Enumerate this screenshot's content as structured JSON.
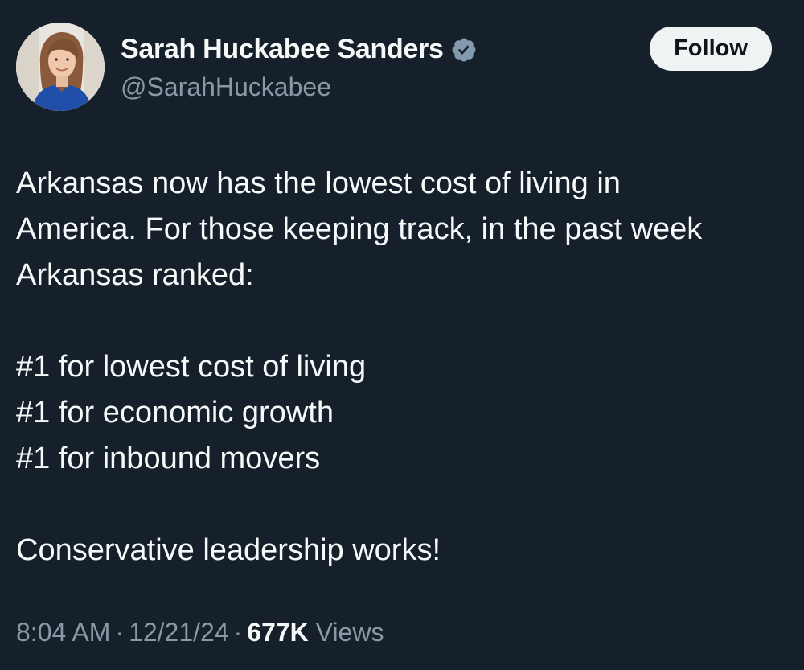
{
  "author": {
    "display_name": "Sarah Huckabee Sanders",
    "handle": "@SarahHuckabee",
    "verified_icon": "verified-badge-gray",
    "avatar_icon": "profile-photo"
  },
  "follow_label": "Follow",
  "tweet": {
    "paragraph_1_lines": [
      "Arkansas now has the lowest cost of living in",
      "America. For those keeping track, in the past week",
      "Arkansas ranked:"
    ],
    "rankings": [
      "#1 for lowest cost of living",
      "#1 for economic growth",
      "#1 for inbound movers"
    ],
    "closing": "Conservative leadership works!"
  },
  "meta": {
    "time": "8:04 AM",
    "date": "12/21/24",
    "separator": "·",
    "views_count": "677K",
    "views_label": "Views"
  },
  "colors": {
    "background": "#15202b",
    "text": "#f7f9f9",
    "secondary_text": "#8b98a5",
    "follow_bg": "#eff3f4",
    "badge": "#829aab"
  }
}
